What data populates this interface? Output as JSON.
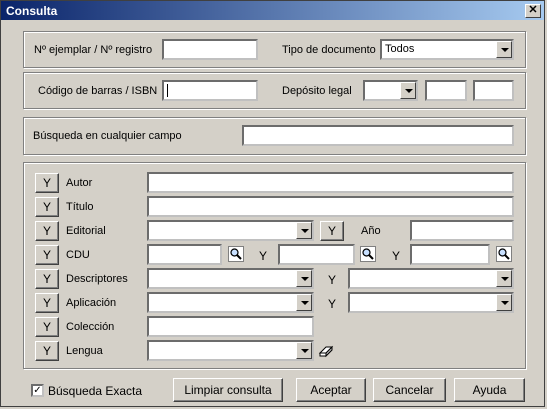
{
  "window": {
    "title": "Consulta",
    "close_glyph": "✕"
  },
  "group1": {
    "ejemplar_label": "Nº ejemplar / Nº registro",
    "ejemplar_value": "",
    "tipo_label": "Tipo de documento",
    "tipo_value": "Todos"
  },
  "group2": {
    "codigo_label": "Código de barras / ISBN",
    "codigo_value": "",
    "deposito_label": "Depósito legal",
    "deposito_value": ""
  },
  "group3": {
    "busqueda_label": "Búsqueda en cualquier campo",
    "busqueda_value": ""
  },
  "group4": {
    "y_label": "Y",
    "autor_label": "Autor",
    "titulo_label": "Título",
    "editorial_label": "Editorial",
    "anio_label": "Año",
    "cdu_label": "CDU",
    "descriptores_label": "Descriptores",
    "aplicacion_label": "Aplicación",
    "coleccion_label": "Colección",
    "lengua_label": "Lengua"
  },
  "footer": {
    "busqueda_exacta_label": "Búsqueda Exacta",
    "busqueda_exacta_checked": true,
    "check_glyph": "✓",
    "limpiar_label": "Limpiar consulta",
    "aceptar_label": "Aceptar",
    "cancelar_label": "Cancelar",
    "ayuda_label": "Ayuda"
  },
  "icons": {
    "magnifier": "magnifier-icon",
    "eraser": "eraser-icon"
  }
}
